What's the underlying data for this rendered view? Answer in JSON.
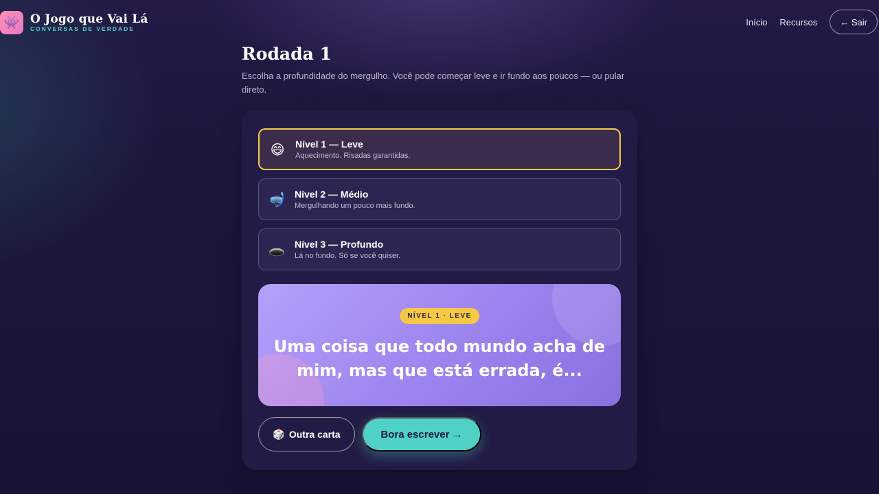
{
  "header": {
    "brand_title": "O Jogo que Vai Lá",
    "brand_subtitle": "CONVERSAS DE VERDADE",
    "logo_icon": "alien-monster-icon",
    "nav": [
      {
        "label": "Início"
      },
      {
        "label": "Recursos"
      }
    ],
    "exit_label": "← Sair"
  },
  "round": {
    "title": "Rodada 1",
    "intro": "Escolha a profundidade do mergulho. Você pode começar leve e ir fundo aos poucos — ou pular direto."
  },
  "levels": [
    {
      "icon": "😄",
      "icon_name": "grinning-face-icon",
      "title": "Nível 1 — Leve",
      "desc": "Aquecimento. Risadas garantidas.",
      "selected": true
    },
    {
      "icon": "🤿",
      "icon_name": "diving-mask-icon",
      "title": "Nível 2 — Médio",
      "desc": "Mergulhando um pouco mais fundo.",
      "selected": false
    },
    {
      "icon": "🕳️",
      "icon_name": "hole-icon",
      "title": "Nível 3 — Profundo",
      "desc": "Lá no fundo. Só se você quiser.",
      "selected": false
    }
  ],
  "card": {
    "badge": "NÍVEL 1 · LEVE",
    "text": "Uma coisa que todo mundo acha de mim, mas que está errada, é..."
  },
  "actions": {
    "other_card_icon": "🎲",
    "other_card_label": "Outra carta",
    "write_label": "Bora escrever →"
  },
  "colors": {
    "accent_teal": "#4fd1c5",
    "accent_yellow": "#f6c945",
    "selected_border": "#f2c94c",
    "card_purple": "#9f85ef"
  }
}
